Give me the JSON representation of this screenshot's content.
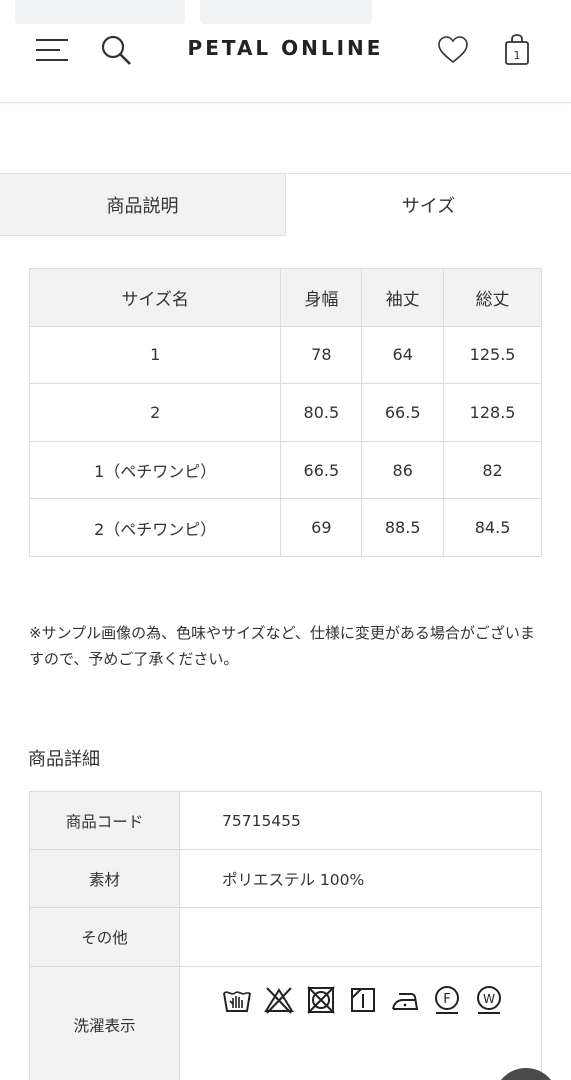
{
  "header": {
    "logo": "PETAL ONLINE",
    "cart_count": "1",
    "icons": {
      "menu": "menu-icon",
      "search": "search-icon",
      "favorite": "heart-icon",
      "cart": "shopping-bag-icon"
    }
  },
  "tabs": [
    {
      "label": "商品説明",
      "active": false
    },
    {
      "label": "サイズ",
      "active": true
    }
  ],
  "size_table": {
    "headers": [
      "サイズ名",
      "身幅",
      "袖丈",
      "総丈"
    ],
    "rows": [
      [
        "1",
        "78",
        "64",
        "125.5"
      ],
      [
        "2",
        "80.5",
        "66.5",
        "128.5"
      ],
      [
        "1（ペチワンピ）",
        "66.5",
        "86",
        "82"
      ],
      [
        "2（ペチワンピ）",
        "69",
        "88.5",
        "84.5"
      ]
    ]
  },
  "note": "※サンプル画像の為、色味やサイズなど、仕様に変更がある場合がございますので、予めご了承ください。",
  "details": {
    "title": "商品詳細",
    "rows": [
      {
        "label": "商品コード",
        "value": "75715455"
      },
      {
        "label": "素材",
        "value": "ポリエステル 100%"
      },
      {
        "label": "その他",
        "value": ""
      },
      {
        "label": "洗濯表示",
        "value": ""
      }
    ],
    "wash_icons": [
      "hand-wash-icon",
      "no-bleach-icon",
      "no-tumble-dry-icon",
      "line-dry-icon",
      "iron-low-icon",
      "dry-clean-f-icon",
      "wet-clean-w-icon"
    ]
  },
  "colors": {
    "border": "#dcdcdc",
    "header_bg": "#f2f2f2",
    "text": "#333333"
  }
}
